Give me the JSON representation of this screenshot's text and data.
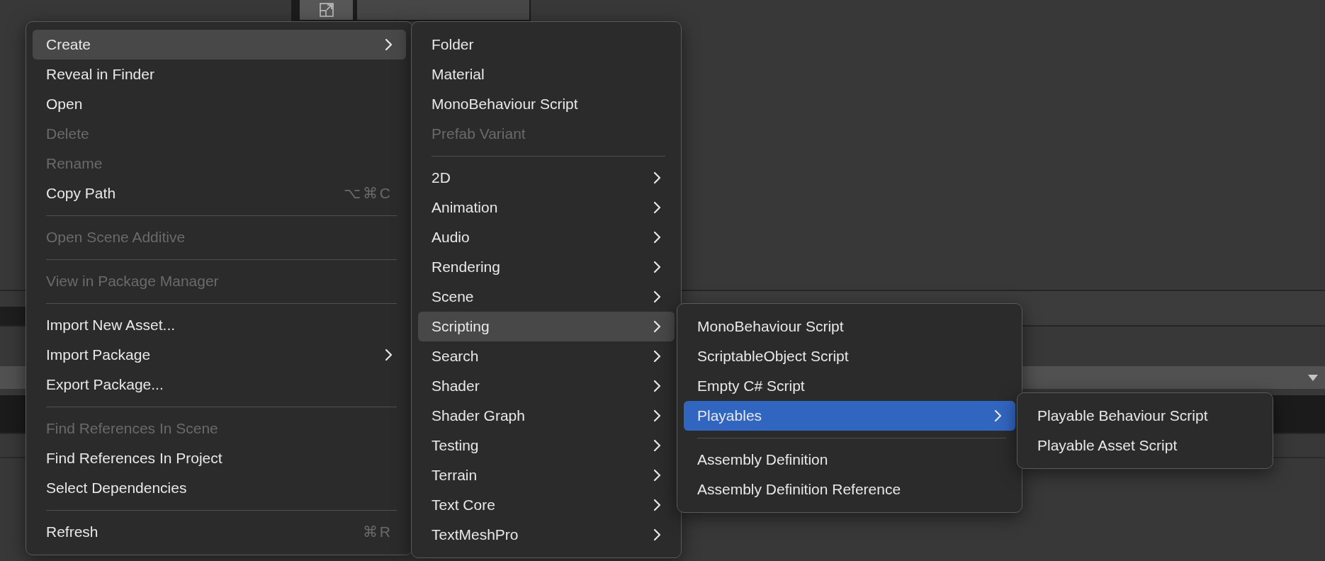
{
  "menus": [
    {
      "items": [
        {
          "kind": "item",
          "label": "Create",
          "submenu": true,
          "expanded": true,
          "selected": false,
          "disabled": false
        },
        {
          "kind": "item",
          "label": "Reveal in Finder",
          "submenu": false,
          "expanded": false,
          "selected": false,
          "disabled": false
        },
        {
          "kind": "item",
          "label": "Open",
          "submenu": false,
          "expanded": false,
          "selected": false,
          "disabled": false
        },
        {
          "kind": "item",
          "label": "Delete",
          "submenu": false,
          "expanded": false,
          "selected": false,
          "disabled": true
        },
        {
          "kind": "item",
          "label": "Rename",
          "submenu": false,
          "expanded": false,
          "selected": false,
          "disabled": true
        },
        {
          "kind": "item",
          "label": "Copy Path",
          "shortcut": "⌥⌘C",
          "submenu": false,
          "expanded": false,
          "selected": false,
          "disabled": false
        },
        {
          "kind": "separator"
        },
        {
          "kind": "item",
          "label": "Open Scene Additive",
          "submenu": false,
          "expanded": false,
          "selected": false,
          "disabled": true
        },
        {
          "kind": "separator"
        },
        {
          "kind": "item",
          "label": "View in Package Manager",
          "submenu": false,
          "expanded": false,
          "selected": false,
          "disabled": true
        },
        {
          "kind": "separator"
        },
        {
          "kind": "item",
          "label": "Import New Asset...",
          "submenu": false,
          "expanded": false,
          "selected": false,
          "disabled": false
        },
        {
          "kind": "item",
          "label": "Import Package",
          "submenu": true,
          "expanded": false,
          "selected": false,
          "disabled": false
        },
        {
          "kind": "item",
          "label": "Export Package...",
          "submenu": false,
          "expanded": false,
          "selected": false,
          "disabled": false
        },
        {
          "kind": "separator"
        },
        {
          "kind": "item",
          "label": "Find References In Scene",
          "submenu": false,
          "expanded": false,
          "selected": false,
          "disabled": true
        },
        {
          "kind": "item",
          "label": "Find References In Project",
          "submenu": false,
          "expanded": false,
          "selected": false,
          "disabled": false
        },
        {
          "kind": "item",
          "label": "Select Dependencies",
          "submenu": false,
          "expanded": false,
          "selected": false,
          "disabled": false
        },
        {
          "kind": "separator"
        },
        {
          "kind": "item",
          "label": "Refresh",
          "shortcut": "⌘R",
          "submenu": false,
          "expanded": false,
          "selected": false,
          "disabled": false
        }
      ]
    },
    {
      "items": [
        {
          "kind": "item",
          "label": "Folder",
          "submenu": false,
          "expanded": false,
          "selected": false,
          "disabled": false
        },
        {
          "kind": "item",
          "label": "Material",
          "submenu": false,
          "expanded": false,
          "selected": false,
          "disabled": false
        },
        {
          "kind": "item",
          "label": "MonoBehaviour Script",
          "submenu": false,
          "expanded": false,
          "selected": false,
          "disabled": false
        },
        {
          "kind": "item",
          "label": "Prefab Variant",
          "submenu": false,
          "expanded": false,
          "selected": false,
          "disabled": true
        },
        {
          "kind": "separator"
        },
        {
          "kind": "item",
          "label": "2D",
          "submenu": true,
          "expanded": false,
          "selected": false,
          "disabled": false
        },
        {
          "kind": "item",
          "label": "Animation",
          "submenu": true,
          "expanded": false,
          "selected": false,
          "disabled": false
        },
        {
          "kind": "item",
          "label": "Audio",
          "submenu": true,
          "expanded": false,
          "selected": false,
          "disabled": false
        },
        {
          "kind": "item",
          "label": "Rendering",
          "submenu": true,
          "expanded": false,
          "selected": false,
          "disabled": false
        },
        {
          "kind": "item",
          "label": "Scene",
          "submenu": true,
          "expanded": false,
          "selected": false,
          "disabled": false
        },
        {
          "kind": "item",
          "label": "Scripting",
          "submenu": true,
          "expanded": true,
          "selected": false,
          "disabled": false
        },
        {
          "kind": "item",
          "label": "Search",
          "submenu": true,
          "expanded": false,
          "selected": false,
          "disabled": false
        },
        {
          "kind": "item",
          "label": "Shader",
          "submenu": true,
          "expanded": false,
          "selected": false,
          "disabled": false
        },
        {
          "kind": "item",
          "label": "Shader Graph",
          "submenu": true,
          "expanded": false,
          "selected": false,
          "disabled": false
        },
        {
          "kind": "item",
          "label": "Testing",
          "submenu": true,
          "expanded": false,
          "selected": false,
          "disabled": false
        },
        {
          "kind": "item",
          "label": "Terrain",
          "submenu": true,
          "expanded": false,
          "selected": false,
          "disabled": false
        },
        {
          "kind": "item",
          "label": "Text Core",
          "submenu": true,
          "expanded": false,
          "selected": false,
          "disabled": false
        },
        {
          "kind": "item",
          "label": "TextMeshPro",
          "submenu": true,
          "expanded": false,
          "selected": false,
          "disabled": false
        }
      ]
    },
    {
      "items": [
        {
          "kind": "item",
          "label": "MonoBehaviour Script",
          "submenu": false,
          "expanded": false,
          "selected": false,
          "disabled": false
        },
        {
          "kind": "item",
          "label": "ScriptableObject Script",
          "submenu": false,
          "expanded": false,
          "selected": false,
          "disabled": false
        },
        {
          "kind": "item",
          "label": "Empty C# Script",
          "submenu": false,
          "expanded": false,
          "selected": false,
          "disabled": false
        },
        {
          "kind": "item",
          "label": "Playables",
          "submenu": true,
          "expanded": true,
          "selected": true,
          "disabled": false
        },
        {
          "kind": "separator"
        },
        {
          "kind": "item",
          "label": "Assembly Definition",
          "submenu": false,
          "expanded": false,
          "selected": false,
          "disabled": false
        },
        {
          "kind": "item",
          "label": "Assembly Definition Reference",
          "submenu": false,
          "expanded": false,
          "selected": false,
          "disabled": false
        }
      ]
    },
    {
      "items": [
        {
          "kind": "item",
          "label": "Playable Behaviour Script",
          "submenu": false,
          "expanded": false,
          "selected": false,
          "disabled": false
        },
        {
          "kind": "item",
          "label": "Playable Asset Script",
          "submenu": false,
          "expanded": false,
          "selected": false,
          "disabled": false
        }
      ]
    }
  ]
}
